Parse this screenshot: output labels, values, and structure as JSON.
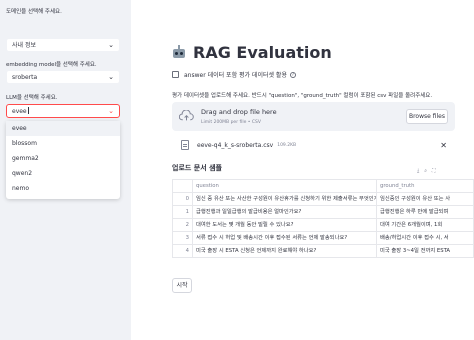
{
  "sidebar": {
    "doc_label": "도메인을 선택해 주세요.",
    "doc_value": "사내 정보",
    "embed_label": "embedding model을 선택해 주세요.",
    "embed_value": "sroberta",
    "llm_label": "LLM을 선택해 주세요.",
    "llm_value": "evee",
    "llm_options": [
      "evee",
      "blossom",
      "gemma2",
      "qwen2",
      "nemo"
    ]
  },
  "main": {
    "title": "RAG Evaluation",
    "checkbox_label": "answer 데이터 포함 평가 데이터셋 활용",
    "help_glyph": "?",
    "instruction": "평가 데이터셋을 업로드해 주세요. 반드시 \"question\", \"ground_truth\" 컬럼이 포함된 csv 파일을 올려주세요.",
    "dropzone_title": "Drag and drop file here",
    "dropzone_sub": "Limit 200MB per file • CSV",
    "browse_label": "Browse files",
    "file_name": "eeve-q4_k_s-sroberta.csv",
    "file_size": "109.2KB",
    "section_title": "업로드 문서 샘플",
    "table": {
      "columns": [
        "",
        "question",
        "ground_truth"
      ],
      "rows": [
        [
          "0",
          "임신 중 유산 또는 사산한 구성원이 유산휴가를 신청하기 위한 제출서류는 무엇인가요?",
          "임신중인 구성원이 유산 또는 사"
        ],
        [
          "1",
          "급행진행과 일일급행의 발급비용은 얼마인가요?",
          "급행진행은 하루 만에 발급되며"
        ],
        [
          "2",
          "대여한 도서는 몇 개월 동안 빌릴 수 있나요?",
          "대여 기간은 6개월이며, 1회"
        ],
        [
          "3",
          "서류 접수 시 허업 및 배송시간 이후 접수된 서류는 언제 발송되나요?",
          "배송/허업시간 이후 접수 시, 서"
        ],
        [
          "4",
          "미국 출장 시 ESTA 신청은 언제까지 완료해야 하나요?",
          "미국 출장 3~4일 전까지 ESTA"
        ]
      ]
    },
    "start_label": "시작"
  }
}
